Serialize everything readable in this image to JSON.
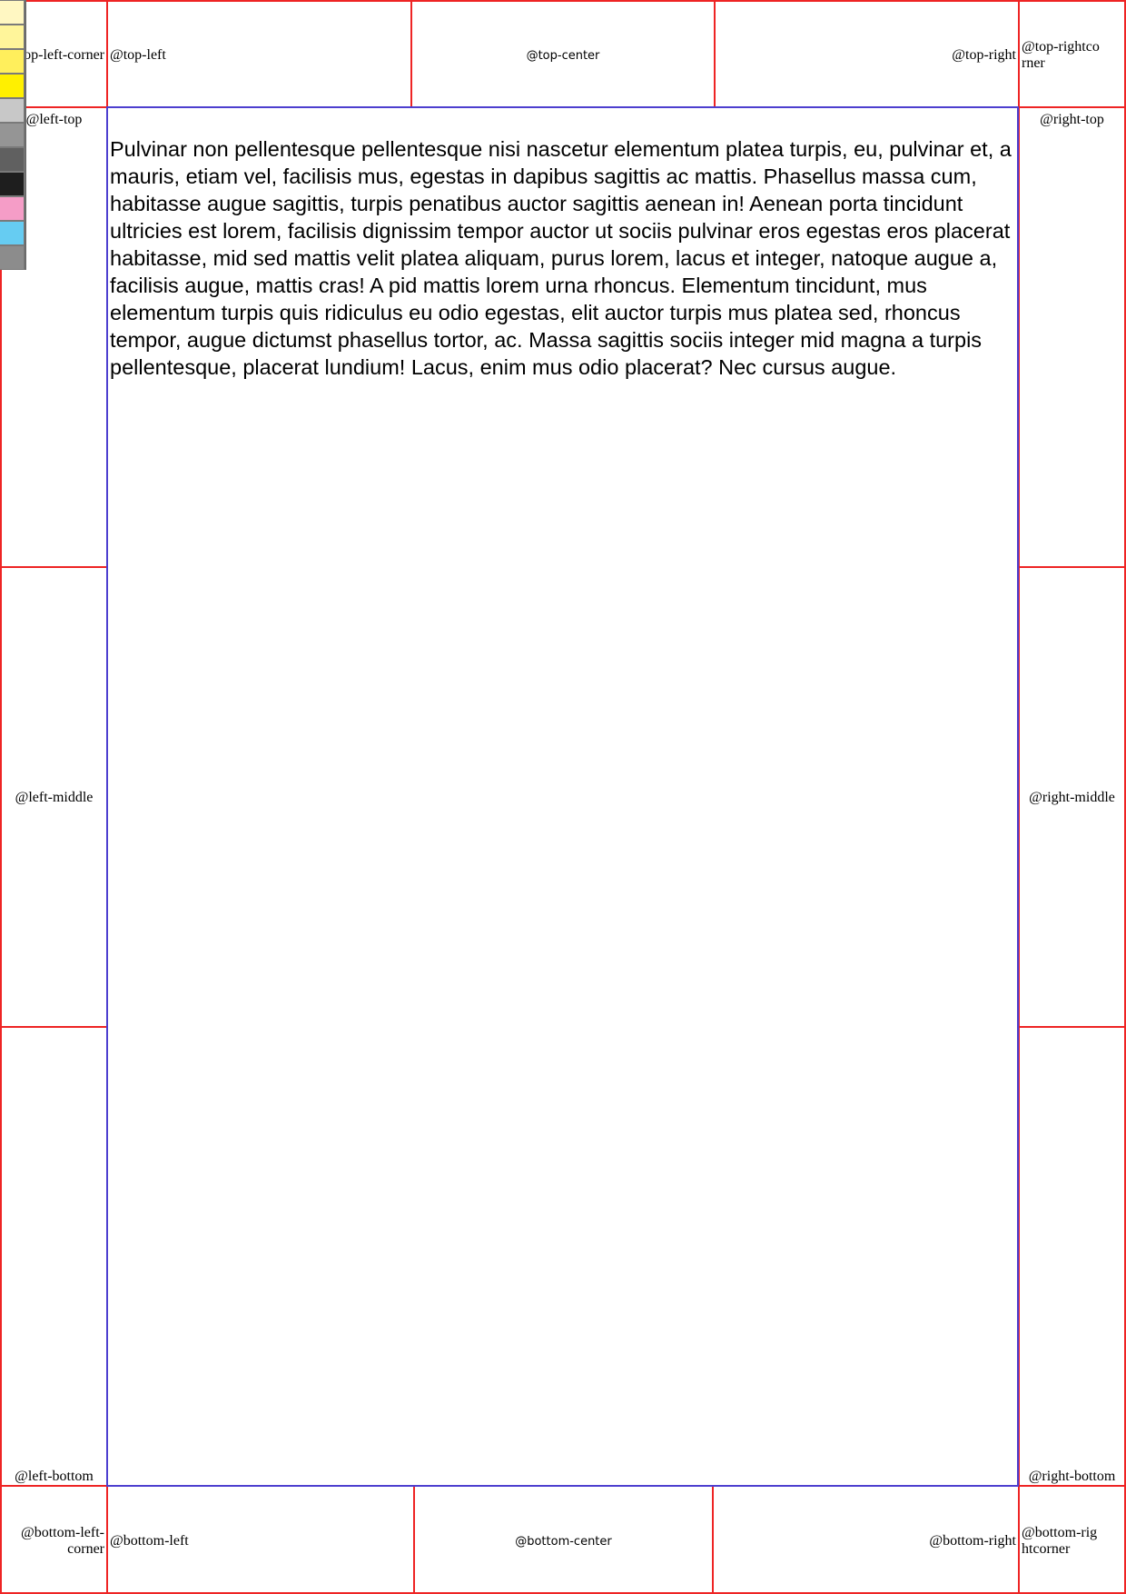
{
  "margins": {
    "top_left_corner": "@top-left-corner",
    "top_left": "@top-left",
    "top_center": "@top-center",
    "top_right": "@top-right",
    "top_right_corner": "@top-rightcorner",
    "left_top": "@left-top",
    "left_middle": "@left-middle",
    "left_bottom": "@left-bottom",
    "right_top": "@right-top",
    "right_middle": "@right-middle",
    "right_bottom": "@right-bottom",
    "bottom_left_corner": "@bottom-left-corner",
    "bottom_left": "@bottom-left",
    "bottom_center": "@bottom-center",
    "bottom_right": "@bottom-right",
    "bottom_right_corner": "@bottom-rightcorner"
  },
  "content": {
    "paragraph": "Pulvinar non pellentesque pellentesque nisi nascetur elementum platea turpis, eu, pulvinar et, a mauris, etiam vel, facilisis mus, egestas in dapibus sagittis ac mattis. Phasellus massa cum, habitasse augue sagittis, turpis penatibus auctor sagittis aenean in! Aenean porta tincidunt ultricies est lorem, facilisis dignissim tempor auctor ut sociis pulvinar eros egestas eros placerat habitasse, mid sed mattis velit platea aliquam, purus lorem, lacus et integer, natoque augue a, facilisis augue, mattis cras! A pid mattis lorem urna rhoncus. Elementum tincidunt, mus elementum turpis quis ridiculus eu odio egestas, elit auctor turpis mus platea sed, rhoncus tempor, augue dictumst phasellus tortor, ac. Massa sagittis sociis integer mid magna a turpis pellentesque, placerat lundium! Lacus, enim mus odio placerat? Nec cursus augue."
  },
  "colors": {
    "margin_box_border": "#ee2424",
    "content_border": "#4d3fcf"
  },
  "color_swatches": [
    "#fff7c2",
    "#fff59a",
    "#ffef5c",
    "#fff000",
    "#c8c8c8",
    "#959595",
    "#606060",
    "#1e1e1e",
    "#f59dc7",
    "#66ccf2",
    "#8c8c8c"
  ]
}
